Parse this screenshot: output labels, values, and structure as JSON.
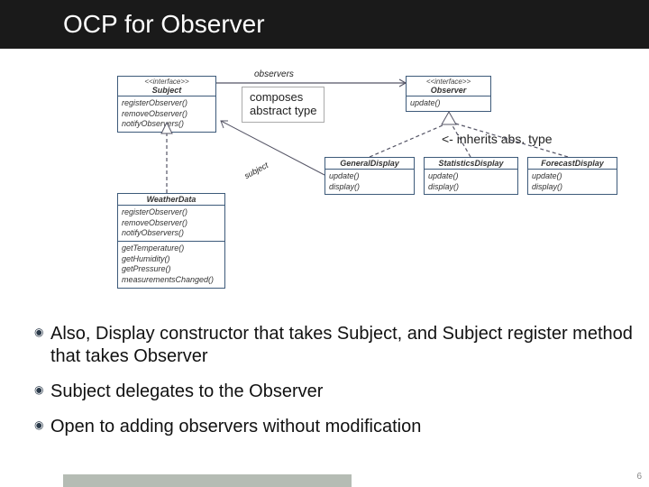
{
  "title": "OCP for Observer",
  "notes": {
    "composes": "composes\nabstract type"
  },
  "annotations": {
    "inherits": "<- inherits abs. type",
    "observers": "observers",
    "subject_assoc": "subject"
  },
  "uml": {
    "subject": {
      "stereo": "<<interface>>",
      "name": "Subject",
      "methods": [
        "registerObserver()",
        "removeObserver()",
        "notifyObservers()"
      ]
    },
    "observer": {
      "stereo": "<<interface>>",
      "name": "Observer",
      "methods": [
        "update()"
      ]
    },
    "weatherdata": {
      "name": "WeatherData",
      "methods1": [
        "registerObserver()",
        "removeObserver()",
        "notifyObservers()"
      ],
      "methods2": [
        "getTemperature()",
        "getHumidity()",
        "getPressure()",
        "measurementsChanged()"
      ]
    },
    "general": {
      "name": "GeneralDisplay",
      "methods": [
        "update()",
        "display()"
      ]
    },
    "stats": {
      "name": "StatisticsDisplay",
      "methods": [
        "update()",
        "display()"
      ]
    },
    "forecast": {
      "name": "ForecastDisplay",
      "methods": [
        "update()",
        "display()"
      ]
    }
  },
  "bullets": [
    "Also, Display constructor that takes Subject, and Subject register method that takes Observer",
    "Subject delegates to the Observer",
    "Open to adding observers without modification"
  ],
  "slidenum": "6"
}
